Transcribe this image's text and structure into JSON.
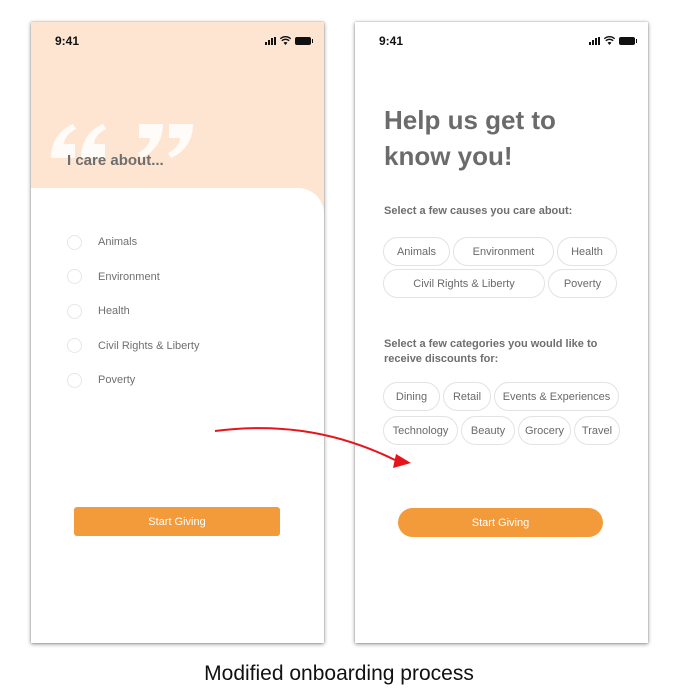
{
  "left_screen": {
    "time": "9:41",
    "title": "I care about...",
    "causes": [
      "Animals",
      "Environment",
      "Health",
      "Civil Rights & Liberty",
      "Poverty"
    ],
    "start_label": "Start Giving"
  },
  "right_screen": {
    "time": "9:41",
    "title_line1": "Help us get to",
    "title_line2": "know you!",
    "causes_prompt": "Select a few causes you care about:",
    "causes_row1": [
      "Animals",
      "Environment",
      "Health"
    ],
    "causes_row2": [
      "Civil Rights & Liberty",
      "Poverty"
    ],
    "categories_prompt": "Select a few categories you would like to receive discounts for:",
    "categories_row1": [
      "Dining",
      "Retail",
      "Events & Experiences"
    ],
    "categories_row2": [
      "Technology",
      "Beauty",
      "Grocery",
      "Travel"
    ],
    "start_label": "Start Giving"
  },
  "caption": "Modified onboarding process",
  "colors": {
    "accent": "#f39a3b",
    "header_bg": "#fde5d1",
    "arrow": "#e8141b"
  }
}
